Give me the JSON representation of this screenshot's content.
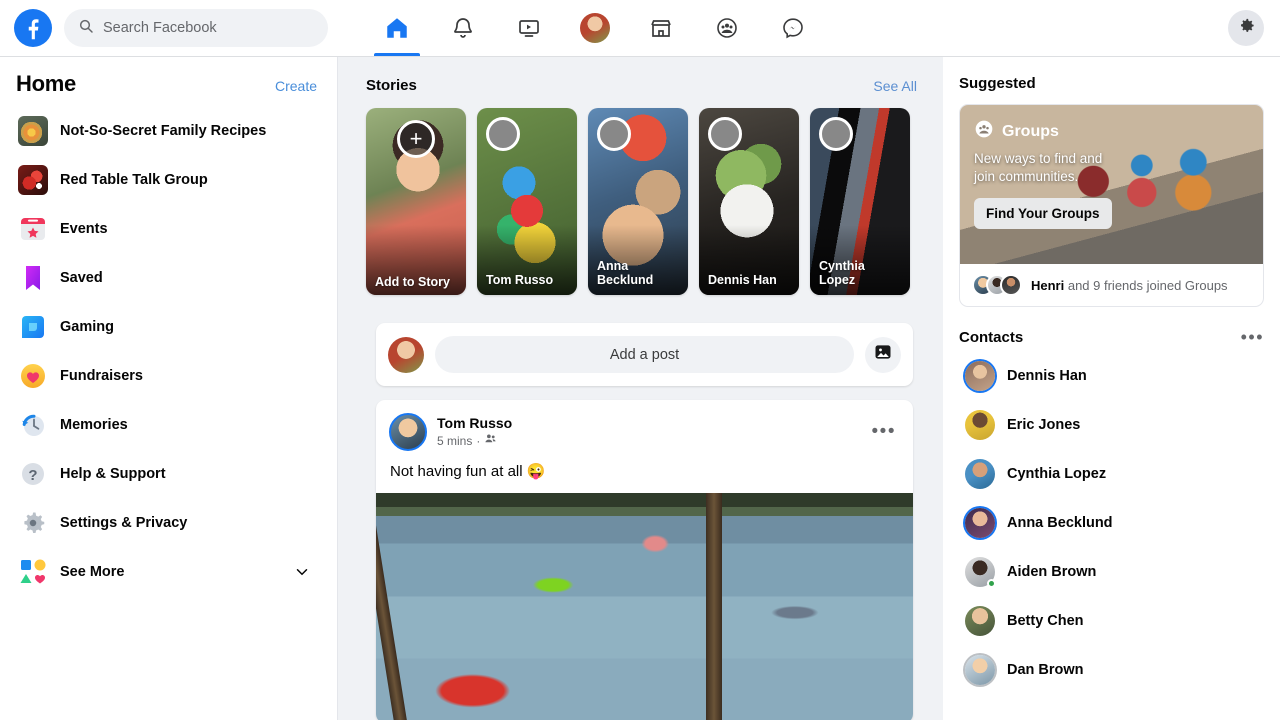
{
  "topbar": {
    "logo_icon": "facebook-logo",
    "search": {
      "placeholder": "Search Facebook",
      "icon": "search-icon",
      "value": ""
    },
    "nav": [
      {
        "name": "home",
        "icon": "home-icon",
        "active": true
      },
      {
        "name": "notifications",
        "icon": "bell-icon",
        "active": false
      },
      {
        "name": "watch",
        "icon": "video-icon",
        "active": false
      },
      {
        "name": "profile",
        "icon": "avatar-icon",
        "active": false
      },
      {
        "name": "marketplace",
        "icon": "store-icon",
        "active": false
      },
      {
        "name": "groups",
        "icon": "groups-icon",
        "active": false
      },
      {
        "name": "messenger",
        "icon": "messenger-icon",
        "active": false
      }
    ],
    "settings_icon": "gear-icon"
  },
  "sidebar": {
    "title": "Home",
    "create_label": "Create",
    "items": [
      {
        "label": "Not-So-Secret Family Recipes",
        "icon": "group-photo-icon"
      },
      {
        "label": "Red Table Talk Group",
        "icon": "group-photo-icon"
      },
      {
        "label": "Events",
        "icon": "events-icon"
      },
      {
        "label": "Saved",
        "icon": "bookmark-icon"
      },
      {
        "label": "Gaming",
        "icon": "gaming-icon"
      },
      {
        "label": "Fundraisers",
        "icon": "heart-icon"
      },
      {
        "label": "Memories",
        "icon": "clock-icon"
      },
      {
        "label": "Help & Support",
        "icon": "question-icon"
      },
      {
        "label": "Settings & Privacy",
        "icon": "gear-icon"
      },
      {
        "label": "See More",
        "icon": "shapes-icon"
      }
    ],
    "see_more_chevron": "chevron-down-icon"
  },
  "feed": {
    "stories": {
      "title": "Stories",
      "see_all": "See All",
      "items": [
        {
          "name": "Add to Story",
          "type": "add",
          "plus_icon": "plus-icon"
        },
        {
          "name": "Tom Russo",
          "type": "story"
        },
        {
          "name": "Anna Becklund",
          "type": "story"
        },
        {
          "name": "Dennis Han",
          "type": "story"
        },
        {
          "name": "Cynthia Lopez",
          "type": "story"
        }
      ]
    },
    "composer": {
      "avatar": "user-avatar",
      "placeholder": "Add a post",
      "photo_icon": "photo-icon"
    },
    "post": {
      "author": "Tom Russo",
      "time": "5 mins",
      "audience_icon": "friends-icon",
      "more_icon": "more-horizontal-icon",
      "text": "Not having fun at all 😜",
      "image_alt": "people-jumping-into-lake"
    }
  },
  "right": {
    "suggested_title": "Suggested",
    "suggested_card": {
      "brand": "Groups",
      "brand_icon": "groups-icon",
      "subtitle": "New ways to find and join communities.",
      "cta": "Find Your Groups",
      "footer_bold": "Henri",
      "footer_rest": " and 9 friends joined Groups"
    },
    "contacts_title": "Contacts",
    "contacts_more_icon": "more-horizontal-icon",
    "contacts": [
      {
        "name": "Dennis Han",
        "ring": "blue",
        "online": false
      },
      {
        "name": "Eric Jones",
        "ring": "none",
        "online": false
      },
      {
        "name": "Cynthia Lopez",
        "ring": "none",
        "online": false
      },
      {
        "name": "Anna Becklund",
        "ring": "blue",
        "online": false
      },
      {
        "name": "Aiden Brown",
        "ring": "none",
        "online": true
      },
      {
        "name": "Betty Chen",
        "ring": "none",
        "online": false
      },
      {
        "name": "Dan Brown",
        "ring": "gray",
        "online": false
      }
    ]
  },
  "colors": {
    "brand_blue": "#1877f2",
    "feed_bg": "#f0f2f5",
    "text_primary": "#050505",
    "text_secondary": "#65676b",
    "online_green": "#31a24c"
  }
}
